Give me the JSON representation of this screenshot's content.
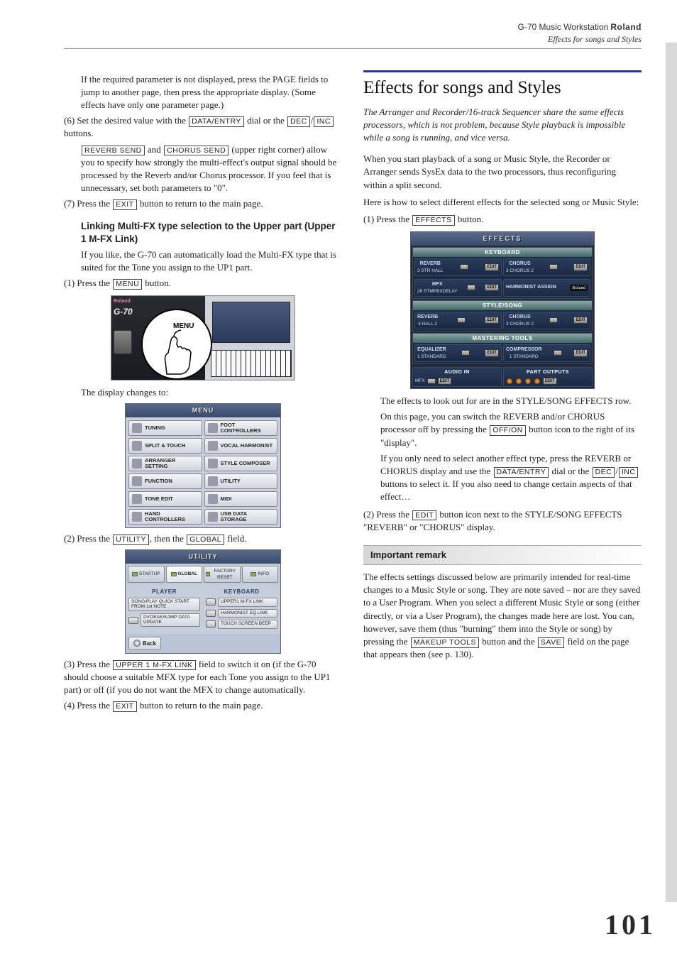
{
  "header": {
    "product": "G-70 Music Workstation",
    "brand": "Roland",
    "subtitle": "Effects for songs and Styles"
  },
  "left": {
    "para_intro": "If the required parameter is not displayed, press the PAGE fields to jump to another page, then press the appropriate display. (Some effects have only one parameter page.)",
    "step6_a": "(6)  Set the desired value with the ",
    "step6_b": " dial or the ",
    "step6_c": "/",
    "step6_d": " buttons.",
    "btn_data_entry": "DATA/ENTRY",
    "btn_dec": "DEC",
    "btn_inc": "INC",
    "reverb_send": "REVERB SEND",
    "chorus_send": "CHORUS SEND",
    "send_para_a": " and ",
    "send_para_b": " (upper right corner) allow you to specify how strongly the multi-effect's output signal should be processed by the Reverb and/or Chorus processor. If you feel that is unnecessary, set both parameters to \"0\".",
    "step7_a": "(7)  Press the ",
    "step7_b": " button to return to the main page.",
    "btn_exit": "EXIT",
    "link_head": "Linking Multi-FX type selection to the Upper part (Upper 1 M-FX Link)",
    "link_para": "If you like, the G-70 can automatically load the Multi-FX type that is suited for the Tone you assign to the UP1 part.",
    "step1_a": "(1)  Press the ",
    "step1_b": " button.",
    "btn_menu": "MENU",
    "fig_menu_label": "MENU",
    "display_changes": "The display changes to:",
    "menu": {
      "title": "MENU",
      "items": [
        "TUNING",
        "FOOT CONTROLLERS",
        "SPLIT & TOUCH",
        "VOCAL HARMONIST",
        "ARRANGER SETTING",
        "STYLE COMPOSER",
        "FUNCTION",
        "UTILITY",
        "TONE EDIT",
        "MIDI",
        "HAND CONTROLLERS",
        "USB DATA STORAGE"
      ]
    },
    "step2_a": "(2)  Press the ",
    "step2_b": ", then the ",
    "step2_c": " field.",
    "btn_utility": "UTILITY",
    "btn_global": "GLOBAL",
    "utility": {
      "title": "UTILITY",
      "tabs": [
        "STARTUP",
        "GLOBAL",
        "FACTORY RESET",
        "INFO"
      ],
      "left_head": "PLAYER",
      "right_head": "KEYBOARD",
      "left_items": [
        "SONG/PLAY QUICK START FROM 1st NOTE",
        "DVORAK/KAMP DATA UPDATE"
      ],
      "right_items": [
        "UPPER1 M-FX LINK",
        "HARMONIST EQ LINK",
        "TOUCH SCREEN BEEP"
      ],
      "back": "Back"
    },
    "step3_a": "(3)  Press the ",
    "step3_b": " field to switch it on (if the G-70 should choose a suitable MFX type for each Tone you assign to the UP1 part) or off (if you do not want the MFX to change automatically.",
    "btn_link": "UPPER 1 M-FX LINK",
    "step4_a": "(4)  Press the ",
    "step4_b": " button to return to the main page."
  },
  "right": {
    "title": "Effects for songs and Styles",
    "intro": "The Arranger and Recorder/16-track Sequencer share the same effects processors, which is not problem, because Style playback is impossible while a song is running, and vice versa.",
    "p1": "When you start playback of a song or Music Style, the Recorder or Arranger sends SysEx data to the two processors, thus reconfiguring within a split second.",
    "p2": "Here is how to select different effects for the selected song or Music Style:",
    "step1_a": "(1)  Press the ",
    "step1_b": " button.",
    "btn_effects": "EFFECTS",
    "fx": {
      "title": "EFFECTS",
      "groups": [
        {
          "name": "KEYBOARD",
          "blocks": [
            {
              "nm": "REVERB",
              "sub": "3 STR HALL"
            },
            {
              "nm": "CHORUS",
              "sub": "3 CHORUS 2"
            },
            {
              "nm": "MFX",
              "sub": "26 STMPBXDELAY"
            },
            {
              "nm": "HARMONIST ASSIGN",
              "sub": ""
            }
          ]
        },
        {
          "name": "STYLE/SONG",
          "blocks": [
            {
              "nm": "REVERB",
              "sub": "3 HALL 2"
            },
            {
              "nm": "CHORUS",
              "sub": "3 CHORUS 2"
            }
          ]
        },
        {
          "name": "MASTERING TOOLS",
          "blocks": [
            {
              "nm": "EQUALIZER",
              "sub": "1 STANDARD"
            },
            {
              "nm": "COMPRESSOR",
              "sub": "1 STANDARD"
            }
          ]
        }
      ],
      "audio_in": "AUDIO IN",
      "audio_fx": "MFX",
      "part_out": "PART OUTPUTS",
      "edit": "EDIT",
      "roland": "Roland"
    },
    "p3": "The effects to look out for are in the STYLE/SONG EFFECTS row.",
    "p4_a": "On this page, you can switch the REVERB and/or CHORUS processor off by pressing the ",
    "p4_b": " button icon to the right of its \"display\".",
    "btn_offon": "OFF/ON",
    "p5_a": "If you only need to select another effect type, press the REVERB or CHORUS display and use the ",
    "p5_b": " dial or the ",
    "p5_c": "/",
    "p5_d": " buttons to select it. If you also need to change certain aspects of that effect…",
    "step2_a": "(2)  Press the ",
    "step2_b": " button icon next to the STYLE/SONG EFFECTS \"REVERB\" or \"CHORUS\" display.",
    "btn_edit": "EDIT",
    "remark_head": "Important remark",
    "remark_a": "The effects settings discussed below are primarily intended for real-time changes to a Music Style or song. They are note saved – nor are they saved to a User Program. When you select a different Music Style or song (either directly, or via a User Program), the changes made here are lost. You can, however, save them (thus \"burning\" them into the Style or song) by pressing the ",
    "remark_b": " button and the ",
    "remark_c": " field on the page that appears then (see p. 130).",
    "btn_makeup": "MAKEUP TOOLS",
    "btn_save": "SAVE"
  },
  "page_number": "101"
}
